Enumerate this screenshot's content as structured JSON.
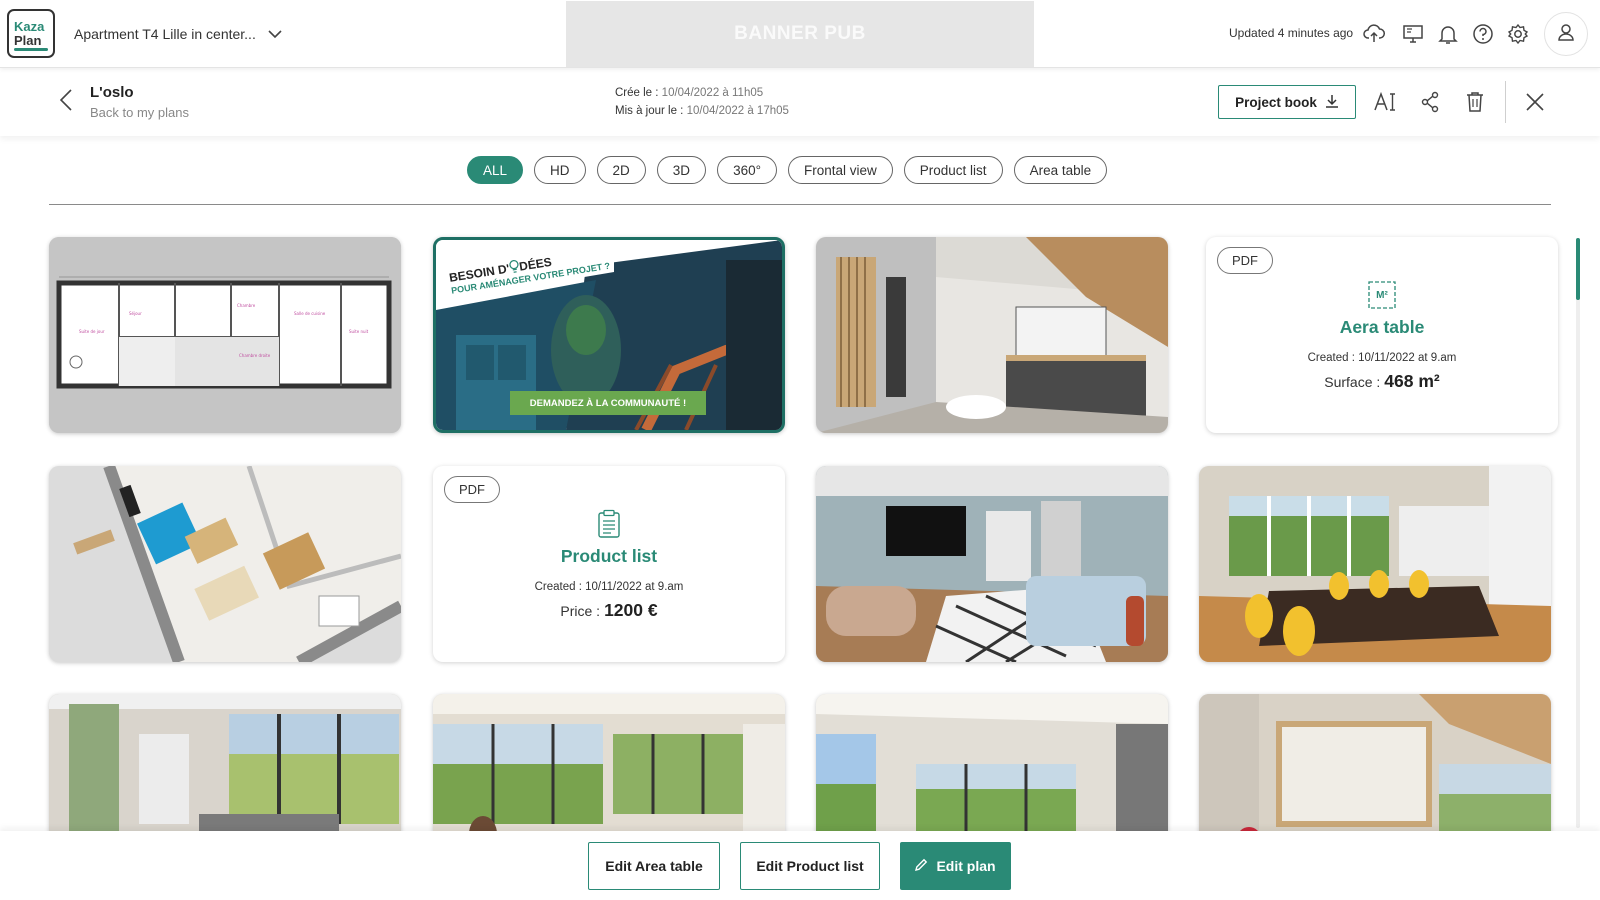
{
  "app": {
    "logo_line1": "Kaza",
    "logo_line2": "Plan",
    "project_name": "Apartment T4 Lille in center...",
    "banner_text": "BANNER PUB",
    "updated_text": "Updated 4 minutes ago"
  },
  "icons": {
    "project_dropdown": "chevron-down-icon",
    "cloud": "cloud-upload-icon",
    "display": "monitor-icon",
    "notifications": "bell-icon",
    "help": "help-icon",
    "settings": "gear-icon",
    "account": "user-icon"
  },
  "plan": {
    "name": "L'oslo",
    "back_label": "Back to my plans",
    "created_label": "Crée le :",
    "created_value": "10/04/2022 à 11h05",
    "updated_label": "Mis à jour le :",
    "updated_value": "10/04/2022 à 17h05",
    "project_book_label": "Project book"
  },
  "filters": [
    {
      "label": "ALL",
      "active": true
    },
    {
      "label": "HD",
      "active": false
    },
    {
      "label": "2D",
      "active": false
    },
    {
      "label": "3D",
      "active": false
    },
    {
      "label": "360°",
      "active": false
    },
    {
      "label": "Frontal view",
      "active": false
    },
    {
      "label": "Product list",
      "active": false
    },
    {
      "label": "Area table",
      "active": false
    }
  ],
  "banner_card": {
    "line1": "BESOIN D'",
    "line1b": "DÉES",
    "line2": "POUR AMÉNAGER VOTRE PROJET ?",
    "cta": "DEMANDEZ À LA COMMUNAUTÉ !"
  },
  "area_card": {
    "badge": "PDF",
    "icon_text": "M²",
    "title": "Aera table",
    "created": "Created : 10/11/2022 at 9.am",
    "metric_label": "Surface :",
    "metric_value": "468 m²"
  },
  "product_card": {
    "badge": "PDF",
    "title": "Product list",
    "created": "Created : 10/11/2022 at 9.am",
    "metric_label": "Price :",
    "metric_value": "1200 €"
  },
  "bottom": {
    "edit_area": "Edit Area table",
    "edit_product": "Edit Product list",
    "edit_plan": "Edit plan"
  },
  "colors": {
    "accent": "#2a8a76",
    "accent_dark": "#1e6f64",
    "banner_bg": "#e6e6e6"
  }
}
